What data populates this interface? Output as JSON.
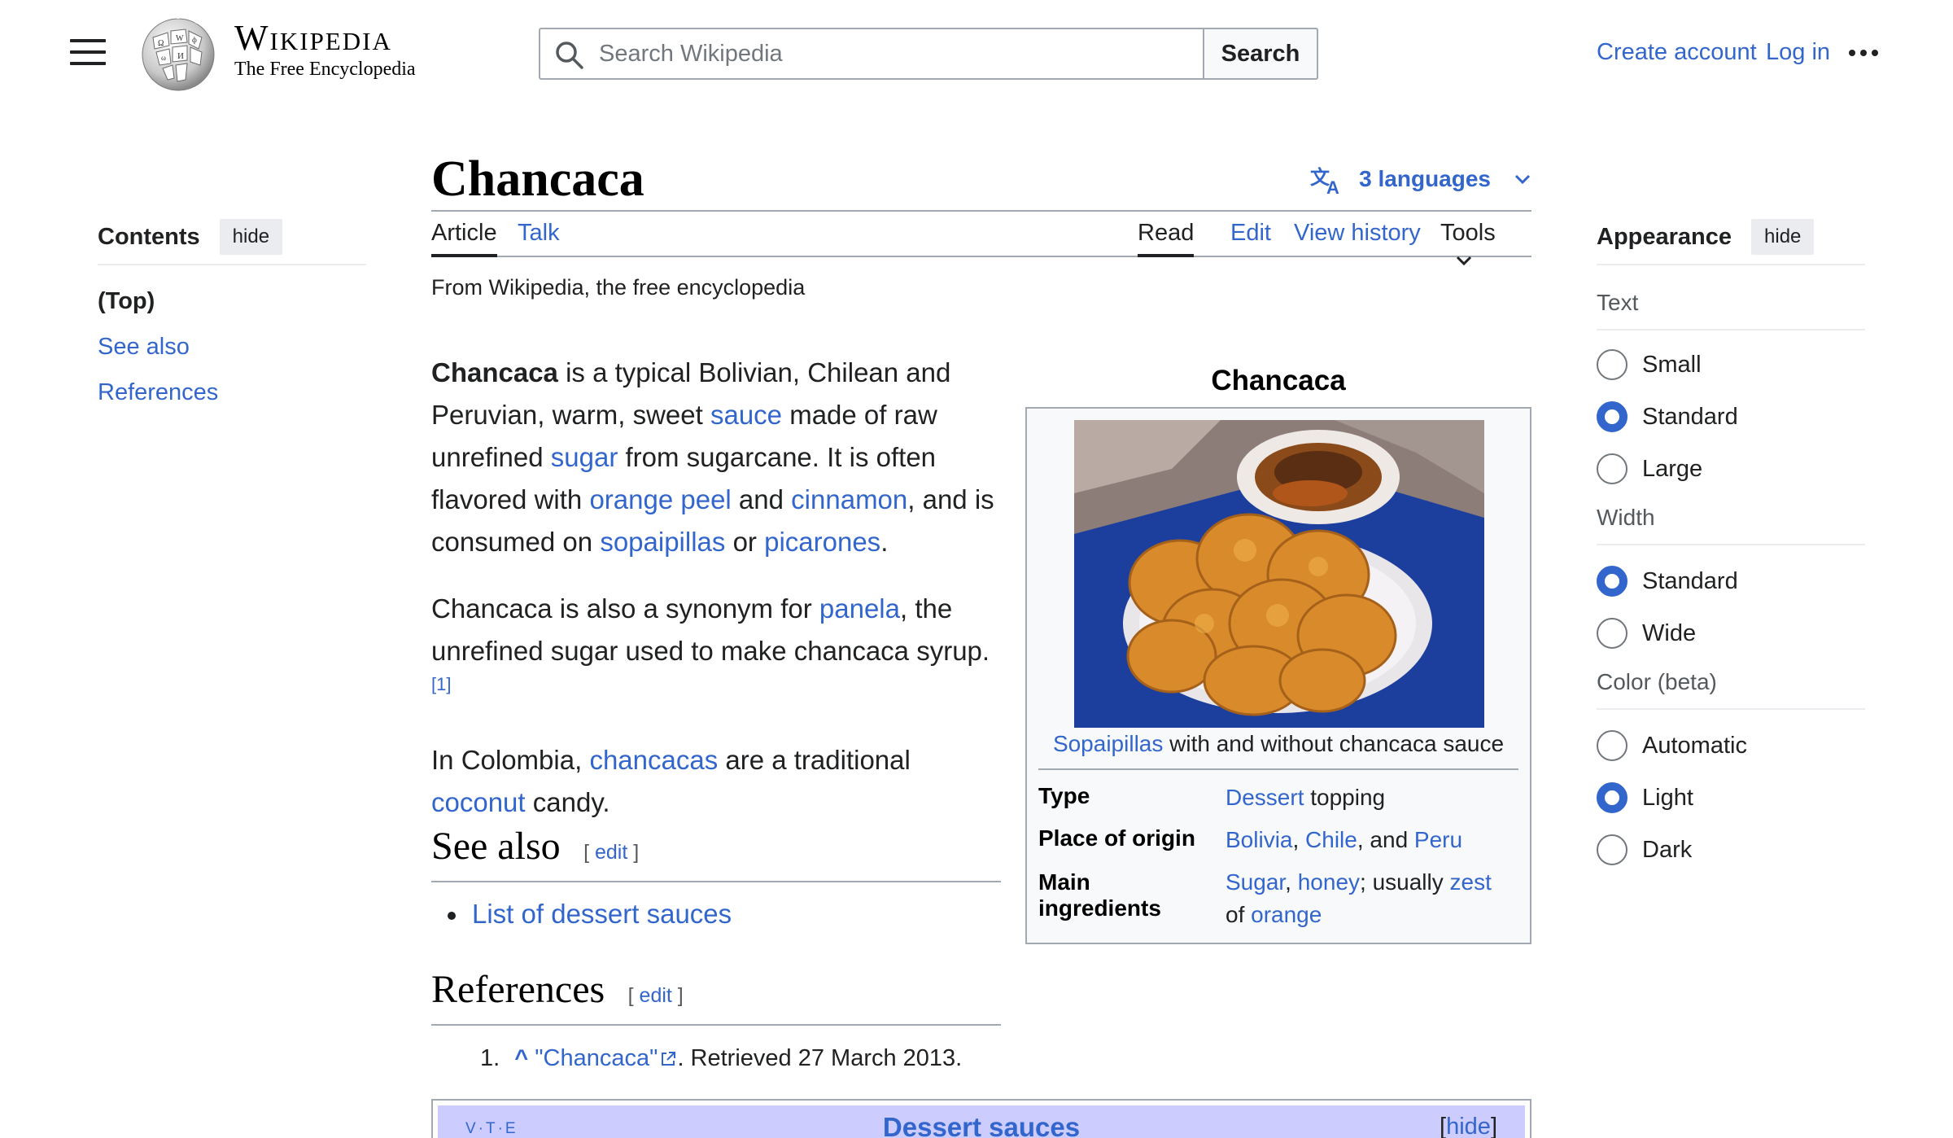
{
  "header": {
    "wordmark": "Wikipedia",
    "tagline": "The Free Encyclopedia",
    "search_placeholder": "Search Wikipedia",
    "search_button": "Search",
    "create_account": "Create account",
    "log_in": "Log in"
  },
  "toc": {
    "title": "Contents",
    "hide": "hide",
    "items": [
      "(Top)",
      "See also",
      "References"
    ]
  },
  "article": {
    "title": "Chancaca",
    "languages": "3 languages",
    "tabs": {
      "article": "Article",
      "talk": "Talk",
      "read": "Read",
      "edit": "Edit",
      "view_history": "View history",
      "tools": "Tools"
    },
    "from": "From Wikipedia, the free encyclopedia",
    "p1": {
      "bold": "Chancaca",
      "t1": " is a typical Bolivian, Chilean and Peruvian, warm, sweet ",
      "l1": "sauce",
      "t2": " made of raw unrefined ",
      "l2": "sugar",
      "t3": " from sugarcane. It is often flavored with ",
      "l3": "orange peel",
      "t4": " and ",
      "l4": "cinnamon",
      "t5": ", and is consumed on ",
      "l5": "sopaipillas",
      "t6": " or ",
      "l6": "picarones",
      "t7": "."
    },
    "p2": {
      "t1": "Chancaca is also a synonym for ",
      "l1": "panela",
      "t2": ", the unrefined sugar used to make chancaca syrup.",
      "ref": "[1]"
    },
    "p3": {
      "t1": "In Colombia, ",
      "l1": "chancacas",
      "t2": " are a traditional ",
      "l2": "coconut",
      "t3": " candy."
    },
    "see_also": {
      "heading": "See also",
      "edit_open": "[ ",
      "edit": "edit",
      "edit_close": " ]",
      "items": [
        "List of dessert sauces"
      ]
    },
    "references": {
      "heading": "References",
      "edit": "edit",
      "num": "1.",
      "caret": "^",
      "link": "\"Chancaca\"",
      "rest": ". Retrieved 27 March 2013."
    }
  },
  "infobox": {
    "title": "Chancaca",
    "caption_link": "Sopaipillas",
    "caption_rest": " with and without chancaca sauce",
    "rows": [
      {
        "label": "Type",
        "v_link1": "Dessert",
        "v_t1": " topping"
      },
      {
        "label": "Place of origin",
        "v_link1": "Bolivia",
        "v_t1": ", ",
        "v_link2": "Chile",
        "v_t2": ", and ",
        "v_link3": "Peru"
      },
      {
        "label_1": "Main",
        "label_2": "ingredients",
        "v_link1": "Sugar",
        "v_t1": ", ",
        "v_link2": "honey",
        "v_t2": "; usually ",
        "v_link3": "zest",
        "v_t3": " of ",
        "v_link4": "orange"
      }
    ]
  },
  "navbox": {
    "vte": "V·T·E",
    "title": "Dessert sauces",
    "hide_open": "[",
    "hide": "hide",
    "hide_close": "]"
  },
  "appearance": {
    "title": "Appearance",
    "hide": "hide",
    "text_label": "Text",
    "text_options": [
      "Small",
      "Standard",
      "Large"
    ],
    "text_selected": "Standard",
    "width_label": "Width",
    "width_options": [
      "Standard",
      "Wide"
    ],
    "width_selected": "Standard",
    "color_label": "Color (beta)",
    "color_options": [
      "Automatic",
      "Light",
      "Dark"
    ],
    "color_selected": "Light"
  },
  "colors": {
    "link": "#3366cc",
    "text": "#202122",
    "border": "#a2a9b1",
    "navbox_head": "#ccccff"
  },
  "icons": [
    "hamburger-icon",
    "wikipedia-globe-logo",
    "search-icon",
    "more-icon",
    "translate-icon",
    "chevron-down-icon",
    "external-link-icon"
  ]
}
